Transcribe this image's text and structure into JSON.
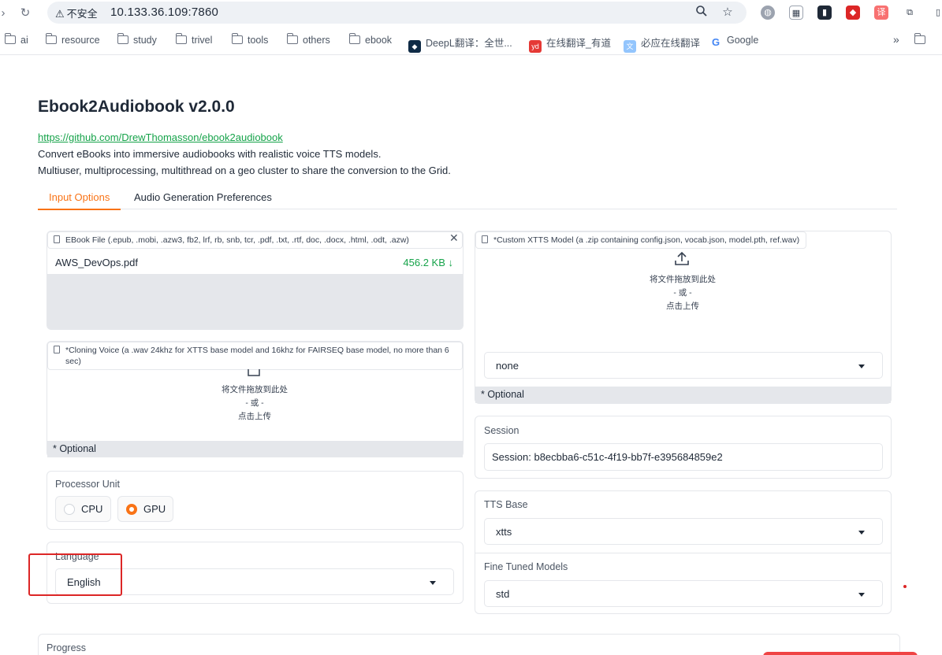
{
  "browser": {
    "security_label": "不安全",
    "url": "10.133.36.109:7860",
    "bookmarks": [
      {
        "label": "ai",
        "kind": "folder"
      },
      {
        "label": "resource",
        "kind": "folder"
      },
      {
        "label": "study",
        "kind": "folder"
      },
      {
        "label": "trivel",
        "kind": "folder"
      },
      {
        "label": "tools",
        "kind": "folder"
      },
      {
        "label": "others",
        "kind": "folder"
      },
      {
        "label": "ebook",
        "kind": "folder"
      },
      {
        "label": "DeepL翻译：全世...",
        "kind": "deepl-icon"
      },
      {
        "label": "在线翻译_有道",
        "kind": "youdao-icon"
      },
      {
        "label": "必应在线翻译",
        "kind": "bing-translate-icon"
      },
      {
        "label": "Google",
        "kind": "google-icon"
      }
    ],
    "overflow": "»"
  },
  "app": {
    "title": "Ebook2Audiobook v2.0.0",
    "repo_link": "https://github.com/DrewThomasson/ebook2audiobook",
    "desc_line1": "Convert eBooks into immersive audiobooks with realistic voice TTS models.",
    "desc_line2": "Multiuser, multiprocessing, multithread on a geo cluster to share the conversion to the Grid."
  },
  "tabs": [
    {
      "label": "Input Options",
      "active": true
    },
    {
      "label": "Audio Generation Preferences",
      "active": false
    }
  ],
  "ebook_file": {
    "label": "EBook File (.epub, .mobi, .azw3, fb2, lrf, rb, snb, tcr, .pdf, .txt, .rtf, doc, .docx, .html, .odt, .azw)",
    "file_name": "AWS_DevOps.pdf",
    "file_size": "456.2 KB ↓"
  },
  "cloning_voice": {
    "label": "*Cloning Voice (a .wav 24khz for XTTS base model and 16khz for FAIRSEQ base model, no more than 6 sec)",
    "drop_line1": "将文件拖放到此处",
    "drop_line2": "- 或 -",
    "drop_line3": "点击上传",
    "optional": "* Optional"
  },
  "custom_model": {
    "label": "*Custom XTTS Model (a .zip containing config.json, vocab.json, model.pth, ref.wav)",
    "drop_line1": "将文件拖放到此处",
    "drop_line2": "- 或 -",
    "drop_line3": "点击上传",
    "select_value": "none",
    "optional": "* Optional"
  },
  "processor": {
    "label": "Processor Unit",
    "options": [
      {
        "label": "CPU",
        "selected": false
      },
      {
        "label": "GPU",
        "selected": true
      }
    ]
  },
  "language": {
    "label": "Language",
    "value": "English"
  },
  "session": {
    "label": "Session",
    "value": "Session: b8ecbba6-c51c-4f19-bb7f-e395684859e2"
  },
  "tts_base": {
    "label": "TTS Base",
    "value": "xtts"
  },
  "fine_tuned": {
    "label": "Fine Tuned Models",
    "value": "std"
  },
  "progress": {
    "label": "Progress"
  },
  "colors": {
    "accent": "#f97316",
    "link": "#16a34a",
    "annotation": "#dc2626"
  }
}
